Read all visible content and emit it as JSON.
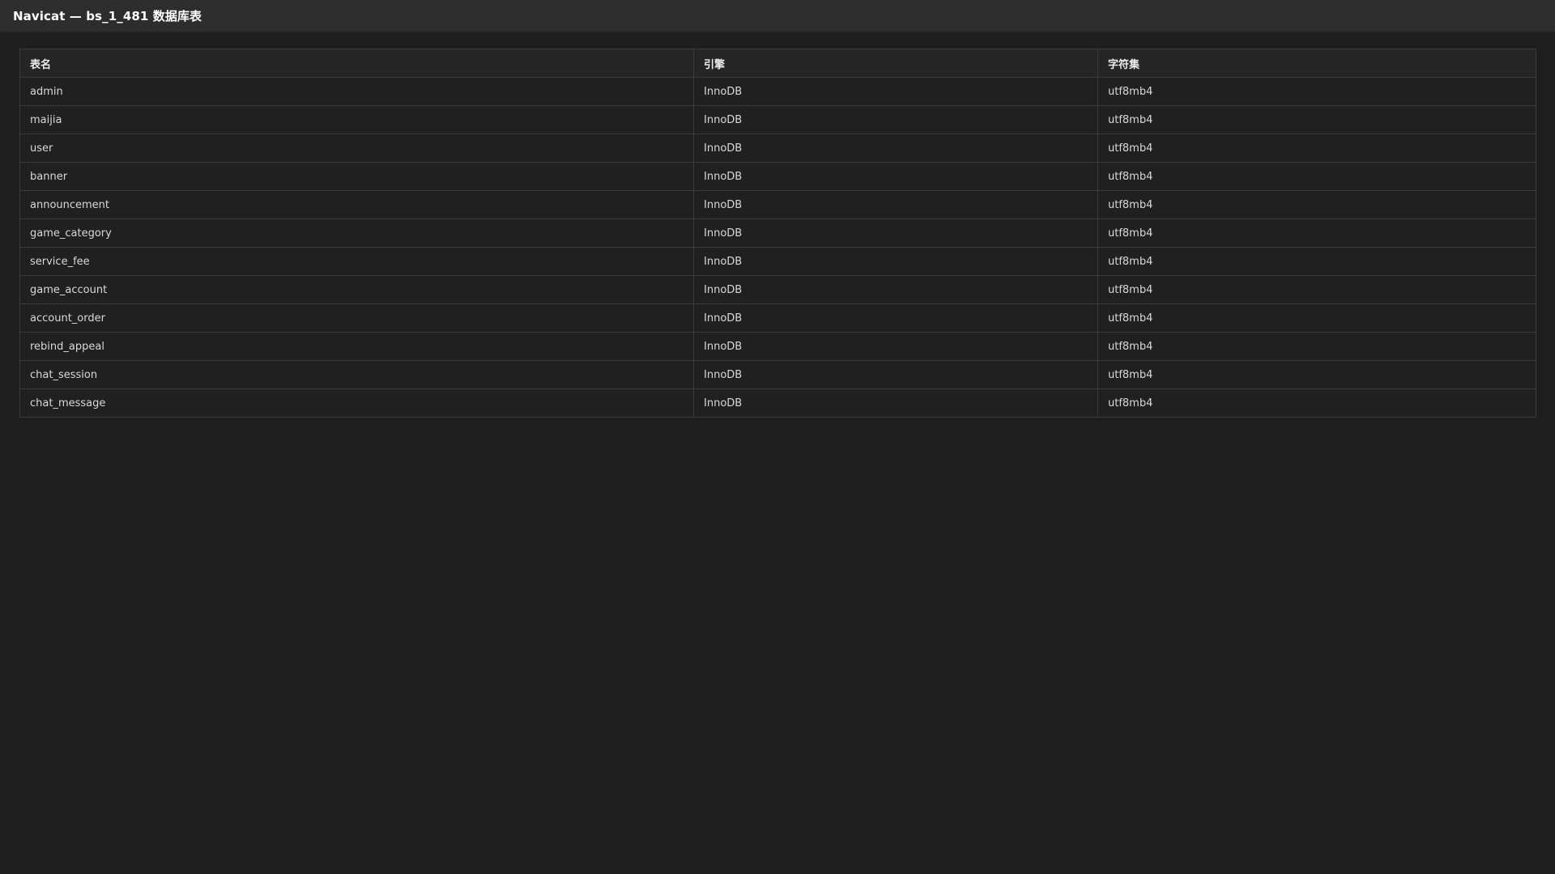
{
  "window": {
    "title": "Navicat — bs_1_481 数据库表"
  },
  "table": {
    "headers": [
      "表名",
      "引擎",
      "字符集"
    ],
    "rows": [
      [
        "admin",
        "InnoDB",
        "utf8mb4"
      ],
      [
        "maijia",
        "InnoDB",
        "utf8mb4"
      ],
      [
        "user",
        "InnoDB",
        "utf8mb4"
      ],
      [
        "banner",
        "InnoDB",
        "utf8mb4"
      ],
      [
        "announcement",
        "InnoDB",
        "utf8mb4"
      ],
      [
        "game_category",
        "InnoDB",
        "utf8mb4"
      ],
      [
        "service_fee",
        "InnoDB",
        "utf8mb4"
      ],
      [
        "game_account",
        "InnoDB",
        "utf8mb4"
      ],
      [
        "account_order",
        "InnoDB",
        "utf8mb4"
      ],
      [
        "rebind_appeal",
        "InnoDB",
        "utf8mb4"
      ],
      [
        "chat_session",
        "InnoDB",
        "utf8mb4"
      ],
      [
        "chat_message",
        "InnoDB",
        "utf8mb4"
      ]
    ]
  },
  "colors": {
    "background": "#1e1e1e",
    "titlebar": "#2d2d2d",
    "border": "#3b3b3b"
  }
}
